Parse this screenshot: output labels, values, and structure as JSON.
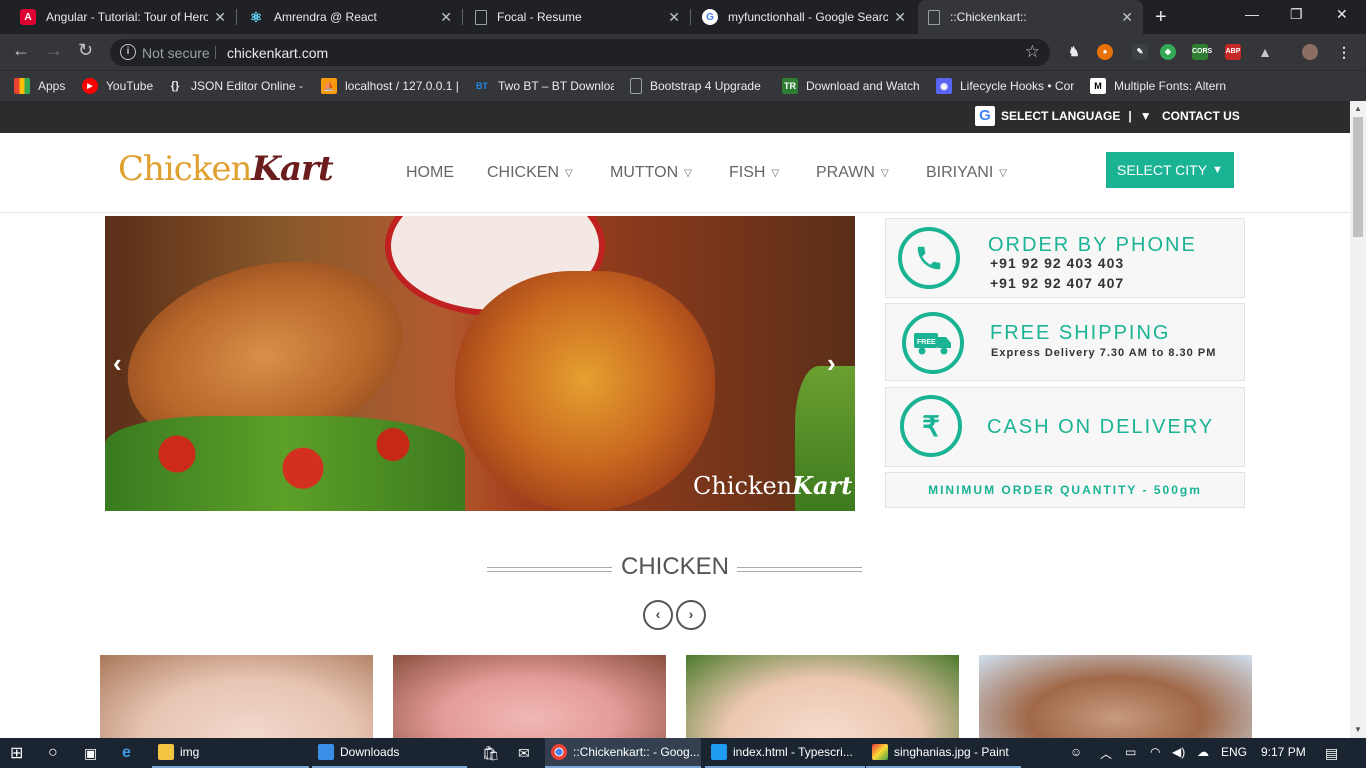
{
  "browser": {
    "tabs": [
      {
        "title": "Angular - Tutorial: Tour of Hero",
        "icon": "angular-icon",
        "color": "#dd0031"
      },
      {
        "title": "Amrendra @ React",
        "icon": "react-icon",
        "color": "#61dafb"
      },
      {
        "title": "Focal - Resume",
        "icon": "page-icon",
        "color": "#9aa0a6"
      },
      {
        "title": "myfunctionhall - Google Searc",
        "icon": "google-icon",
        "color": "#4285f4"
      },
      {
        "title": "::Chickenkart::",
        "icon": "page-icon",
        "color": "#9aa0a6",
        "active": true
      }
    ],
    "new_tab": "+",
    "window_controls": {
      "minimize": "—",
      "restore": "❐",
      "close": "✕"
    },
    "security": "Not secure",
    "url": "chickenkart.com",
    "bookmarks": [
      {
        "label": "Apps",
        "icon": "apps-grid-icon",
        "color": "#e8453c"
      },
      {
        "label": "YouTube",
        "icon": "youtube-icon",
        "color": "#ff0000"
      },
      {
        "label": "JSON Editor Online -",
        "icon": "json-icon",
        "color": "#202124"
      },
      {
        "label": "localhost / 127.0.0.1 |",
        "icon": "phpmyadmin-icon",
        "color": "#f89c0e"
      },
      {
        "label": "Two BT – BT Downloa",
        "icon": "bt-icon",
        "color": "#1e88e5"
      },
      {
        "label": "Bootstrap 4 Upgrade",
        "icon": "page-icon",
        "color": "#9aa0a6"
      },
      {
        "label": "Download and Watch",
        "icon": "tr-icon",
        "color": "#2e7d32"
      },
      {
        "label": "Lifecycle Hooks • Cor",
        "icon": "discord-icon",
        "color": "#5865f2"
      },
      {
        "label": "Multiple Fonts: Altern",
        "icon": "medium-icon",
        "color": "#000000"
      }
    ]
  },
  "site": {
    "topbar": {
      "language": "SELECT LANGUAGE",
      "language_sep": "|",
      "language_caret": "▼",
      "contact": "CONTACT US"
    },
    "logo": {
      "part1": "Chicken",
      "part2": "Kart"
    },
    "nav": [
      {
        "label": "HOME",
        "dropdown": false
      },
      {
        "label": "CHICKEN",
        "dropdown": true
      },
      {
        "label": "MUTTON",
        "dropdown": true
      },
      {
        "label": "FISH",
        "dropdown": true
      },
      {
        "label": "PRAWN",
        "dropdown": true
      },
      {
        "label": "BIRIYANI",
        "dropdown": true
      }
    ],
    "chevron": "⌄",
    "select_city": "SELECT CITY",
    "slider": {
      "prev": "‹",
      "next": "›",
      "watermark1": "Chicken",
      "watermark2": "Kart"
    },
    "info_boxes": {
      "phone": {
        "title": "ORDER BY PHONE",
        "lines": [
          "+91 92 92 403 403",
          "+91 92 92 407 407"
        ]
      },
      "shipping": {
        "title": "FREE SHIPPING",
        "subtitle": "Express Delivery 7.30 AM to 8.30 PM",
        "truck_label": "FREE"
      },
      "cod": {
        "title": "CASH ON DELIVERY",
        "symbol": "₹"
      },
      "min_order": "MINIMUM ORDER QUANTITY - 500gm"
    },
    "section": {
      "title": "CHICKEN",
      "prev": "‹",
      "next": "›"
    },
    "accent": "#1ab394"
  },
  "taskbar": {
    "items": [
      {
        "label": "img",
        "icon": "folder-icon"
      },
      {
        "label": "Downloads",
        "icon": "download-folder-icon"
      },
      {
        "label": "::Chickenkart:: - Goog...",
        "icon": "chrome-icon"
      },
      {
        "label": "index.html - Typescri...",
        "icon": "vscode-icon"
      },
      {
        "label": "singhanias.jpg - Paint",
        "icon": "paint-icon"
      }
    ],
    "language": "ENG",
    "time": "9:17 PM"
  }
}
